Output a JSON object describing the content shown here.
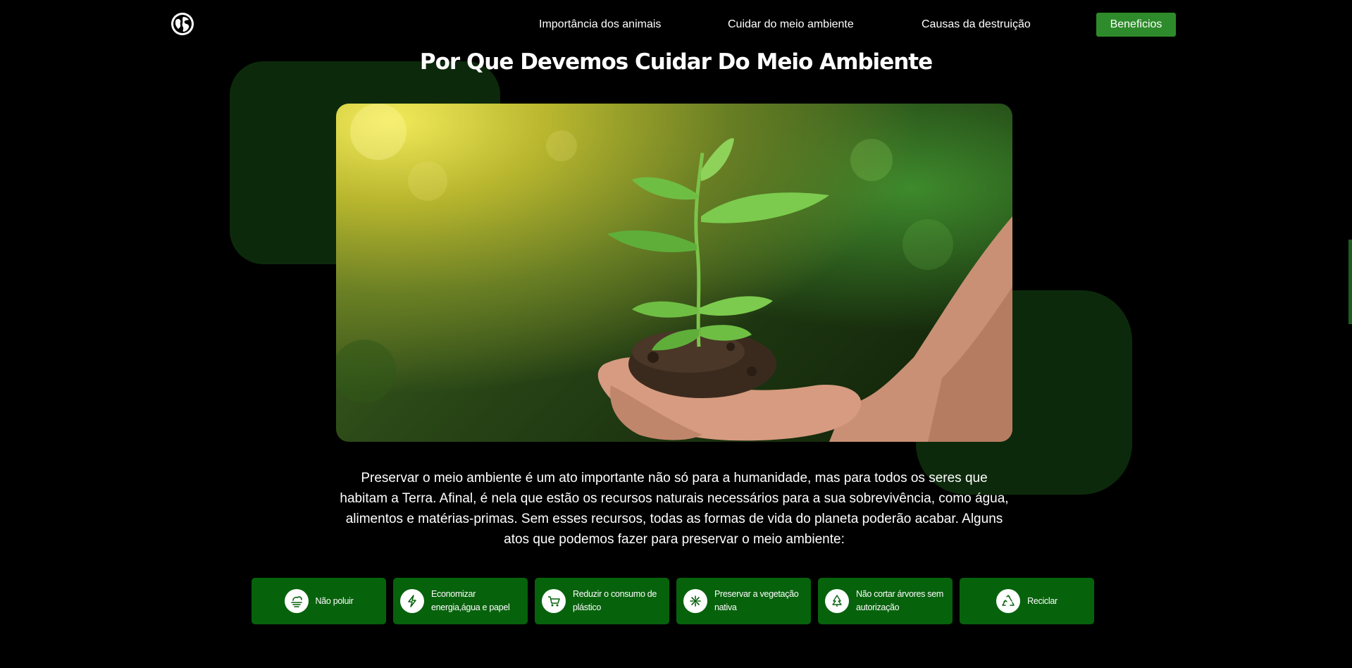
{
  "nav": {
    "links": [
      {
        "label": "Importância dos animais"
      },
      {
        "label": "Cuidar do meio ambiente"
      },
      {
        "label": "Causas da destruição"
      }
    ],
    "cta_label": "Beneficios",
    "logo_icon": "globe-icon"
  },
  "section": {
    "title": "Por Que Devemos Cuidar Do Meio Ambiente",
    "description": "Preservar o meio ambiente é um ato importante não só para a humanidade, mas para todos os seres que habitam a Terra. Afinal, é nela que estão os recursos naturais necessários para a sua sobrevivência, como água, alimentos e matérias-primas. Sem esses recursos, todas as formas de vida do planeta poderão acabar. Alguns atos que podemos fazer para preservar o meio ambiente:",
    "hero_image": "hands-holding-seedling"
  },
  "actions": [
    {
      "label": "Não poluir",
      "icon": "smog-icon"
    },
    {
      "label": "Economizar energia,água e papel",
      "icon": "lightning-icon"
    },
    {
      "label": "Reduzir o consumo de plástico",
      "icon": "cart-icon"
    },
    {
      "label": "Preservar a vegetação nativa",
      "icon": "leaf-icon"
    },
    {
      "label": "Não cortar árvores sem autorização",
      "icon": "tree-icon"
    },
    {
      "label": "Reciclar",
      "icon": "recycle-icon"
    }
  ],
  "colors": {
    "background": "#000000",
    "accent": "#2e8b2b",
    "card": "#07620c",
    "decor": "#0c2a0b"
  }
}
